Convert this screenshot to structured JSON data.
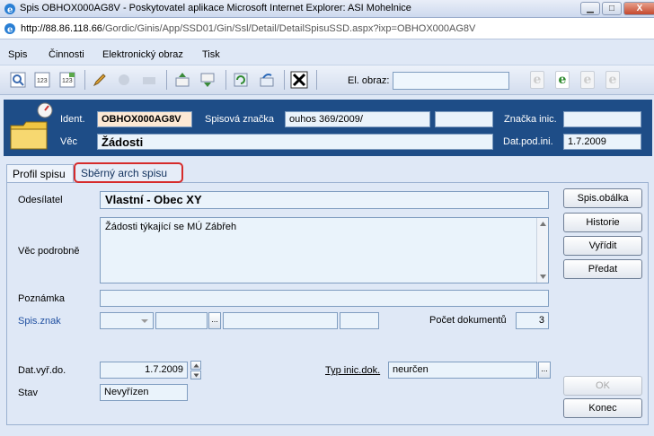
{
  "window": {
    "title": "Spis OBHOX000AG8V - Poskytovatel aplikace Microsoft Internet Explorer: ASI Mohelnice",
    "minimize": "▁",
    "maximize": "□",
    "close": "X"
  },
  "address": {
    "host": "http://88.86.118.66",
    "path": "/Gordic/Ginis/App/SSD01/Gin/Ssl/Detail/DetailSpisuSSD.aspx?ixp=OBHOX000AG8V"
  },
  "menu": [
    "Spis",
    "Činnosti",
    "Elektronický obraz",
    "Tisk"
  ],
  "toolbar": {
    "el_obraz_label": "El. obraz:",
    "el_obraz_value": "",
    "icons": [
      "view-icon",
      "counter-12-icon",
      "counter-12b-icon",
      "edit-icon",
      "settings-icon",
      "print-icon",
      "upload-icon",
      "download-icon",
      "refresh-icon",
      "transfer-icon",
      "close-x-icon",
      "edoc-icon",
      "edoc-add-icon",
      "edoc-remove-icon",
      "edoc-info-icon"
    ]
  },
  "header": {
    "ident_label": "Ident.",
    "ident_value": "OBHOX000AG8V",
    "spisova_label": "Spisová značka",
    "spisova_value": "ouhos 369/2009/",
    "spisova_extra": "",
    "znacka_label": "Značka inic.",
    "znacka_value": "",
    "vec_label": "Věc",
    "vec_value": "Žádosti",
    "datpod_label": "Dat.pod.ini.",
    "datpod_value": "1.7.2009"
  },
  "tabs": {
    "profil": "Profil spisu",
    "sberny": "Sběrný arch spisu"
  },
  "form": {
    "odesilatel_label": "Odesílatel",
    "odesilatel_value": "Vlastní - Obec XY",
    "vec_podrobne_label": "Věc podrobně",
    "vec_podrobne_value": "Žádosti týkající se MÚ Zábřeh",
    "poznamka_label": "Poznámka",
    "poznamka_value": "",
    "spis_znak_label": "Spis.znak",
    "pocet_label": "Počet dokumentů",
    "pocet_value": "3",
    "datvyr_label": "Dat.vyř.do.",
    "datvyr_value": "1.7.2009",
    "typ_label": "Typ inic.dok.",
    "typ_value": "neurčen",
    "stav_label": "Stav",
    "stav_value": "Nevyřízen",
    "ellipsis": "..."
  },
  "buttons": {
    "obalka": "Spis.obálka",
    "historie": "Historie",
    "vyridit": "Vyřídit",
    "predat": "Předat",
    "ok": "OK",
    "konec": "Konec"
  },
  "colors": {
    "header_band": "#1e4d87",
    "panel_bg": "#dfe8f6",
    "highlight_ring": "#d62b2b",
    "ident_field_bg": "#fde9d5"
  }
}
